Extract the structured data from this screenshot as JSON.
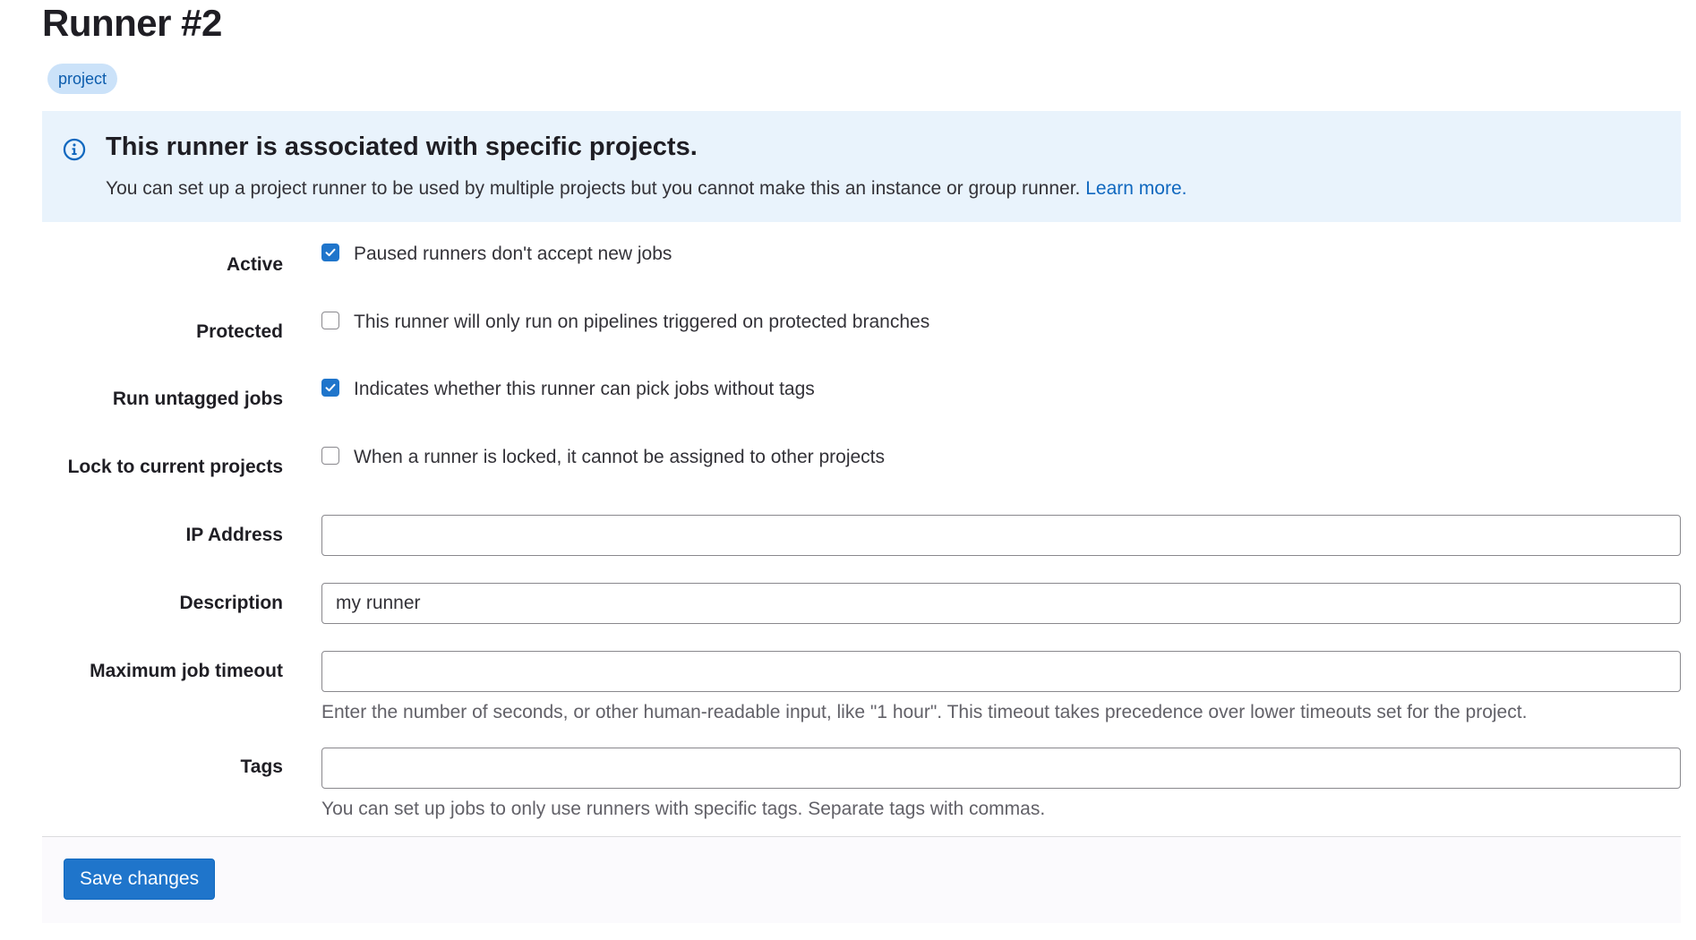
{
  "page": {
    "title": "Runner #2",
    "badge": "project"
  },
  "alert": {
    "icon": "info-icon",
    "title": "This runner is associated with specific projects.",
    "body": "You can set up a project runner to be used by multiple projects but you cannot make this an instance or group runner.",
    "link": "Learn more."
  },
  "form": {
    "active": {
      "label": "Active",
      "checked": true,
      "text": "Paused runners don't accept new jobs"
    },
    "protected": {
      "label": "Protected",
      "checked": false,
      "text": "This runner will only run on pipelines triggered on protected branches"
    },
    "run_untagged": {
      "label": "Run untagged jobs",
      "checked": true,
      "text": "Indicates whether this runner can pick jobs without tags"
    },
    "locked": {
      "label": "Lock to current projects",
      "checked": false,
      "text": "When a runner is locked, it cannot be assigned to other projects"
    },
    "ip_address": {
      "label": "IP Address",
      "value": ""
    },
    "description": {
      "label": "Description",
      "value": "my runner"
    },
    "max_timeout": {
      "label": "Maximum job timeout",
      "value": "",
      "help": "Enter the number of seconds, or other human-readable input, like \"1 hour\". This timeout takes precedence over lower timeouts set for the project."
    },
    "tags": {
      "label": "Tags",
      "value": "",
      "help": "You can set up jobs to only use runners with specific tags. Separate tags with commas."
    }
  },
  "footer": {
    "save_label": "Save changes"
  },
  "colors": {
    "accent": "#1f75cb",
    "link": "#1068bf",
    "alert_bg": "#e9f3fc",
    "badge_bg": "#cbe2f9"
  }
}
